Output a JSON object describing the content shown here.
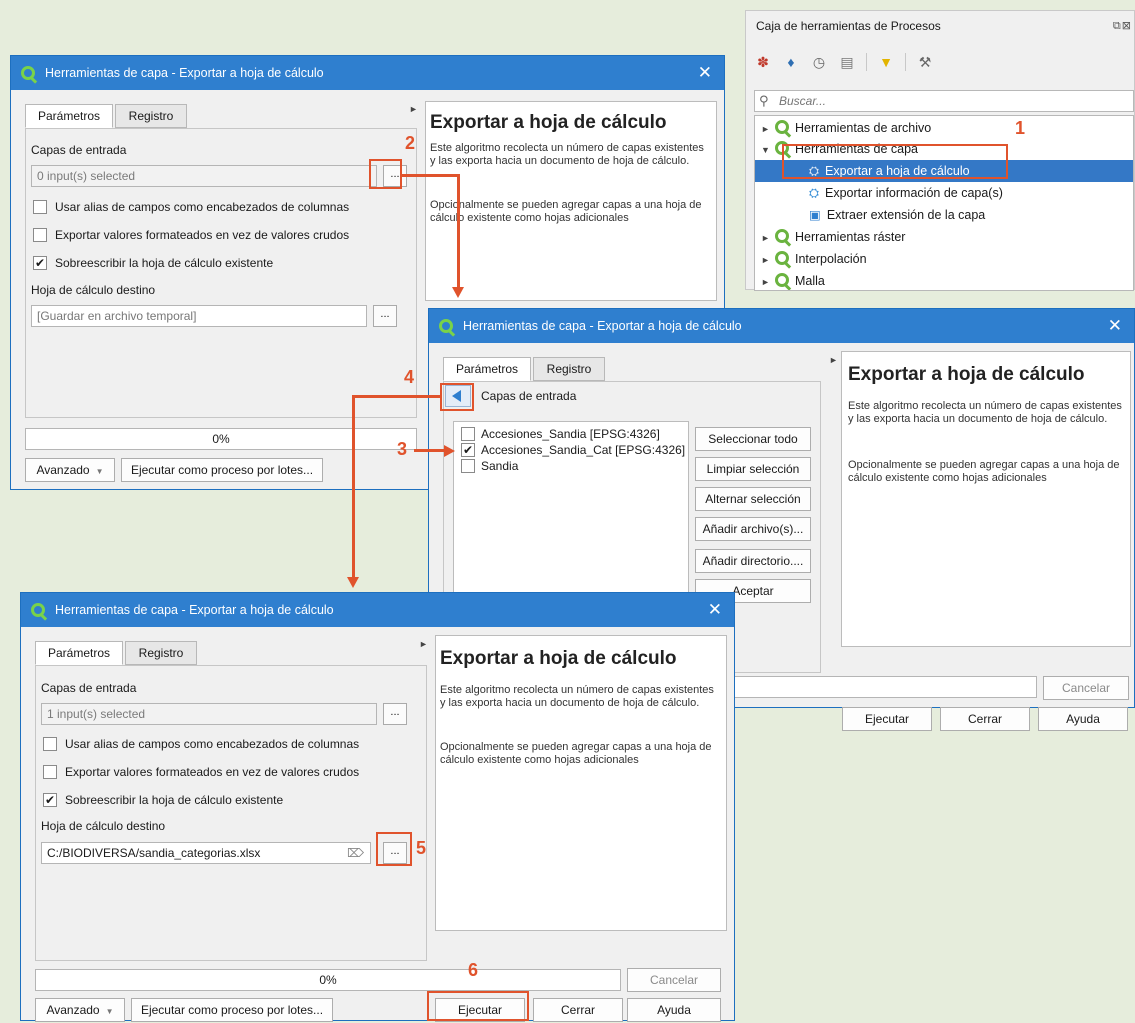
{
  "toolbox": {
    "title": "Caja de herramientas de Procesos",
    "window_buttons": "⧉⊠",
    "search_placeholder": "Buscar...",
    "toolbar_icons": [
      "models-icon",
      "python-script-icon",
      "history-icon",
      "results-viewer-icon",
      "edit-rendering-styles-icon",
      "options-wrench-icon"
    ],
    "tree": [
      {
        "label": "Herramientas de archivo",
        "expanded": false
      },
      {
        "label": "Herramientas de capa",
        "expanded": true
      },
      {
        "label": "Exportar a hoja de cálculo",
        "selected": true
      },
      {
        "label": "Exportar información de capa(s)"
      },
      {
        "label": "Extraer extensión de la capa"
      },
      {
        "label": "Herramientas ráster",
        "expanded": false
      },
      {
        "label": "Interpolación",
        "expanded": false
      },
      {
        "label": "Malla",
        "expanded": false
      }
    ]
  },
  "dialog_title": "Herramientas de capa - Exportar a hoja de cálculo",
  "tabs": {
    "params": "Parámetros",
    "log": "Registro"
  },
  "form": {
    "input_layers_label": "Capas de entrada",
    "input_layers_value_before": "0 input(s) selected",
    "input_layers_value_after": "1 input(s) selected",
    "use_alias": "Usar alias de campos como encabezados de columnas",
    "formatted_values": "Exportar valores formateados en vez de valores crudos",
    "overwrite": "Sobreescribir la hoja de cálculo existente",
    "destination_label": "Hoja de cálculo destino",
    "destination_placeholder": "[Guardar en archivo temporal]",
    "destination_value": "C:/BIODIVERSA/sandia_categorias.xlsx",
    "browse": "..."
  },
  "info": {
    "heading": "Exportar a hoja de cálculo",
    "para1": "Este algoritmo recolecta un número de capas existentes y las exporta hacia un documento de hoja de cálculo.",
    "para2": "Opcionalmente se pueden agregar capas a una hoja de cálculo existente como hojas adicionales"
  },
  "footer": {
    "progress": "0%",
    "progress_fraction": 0,
    "cancel": "Cancelar",
    "advanced": "Avanzado",
    "batch": "Ejecutar como proceso por lotes...",
    "run": "Ejecutar",
    "close": "Cerrar",
    "help": "Ayuda"
  },
  "selector": {
    "title": "Capas de entrada",
    "layers": [
      {
        "name": "Accesiones_Sandia [EPSG:4326]",
        "checked": false
      },
      {
        "name": "Accesiones_Sandia_Cat [EPSG:4326]",
        "checked": true
      },
      {
        "name": "Sandia",
        "checked": false
      }
    ],
    "buttons": [
      "Seleccionar todo",
      "Limpiar selección",
      "Alternar selección",
      "Añadir archivo(s)...",
      "Añadir directorio....",
      "Aceptar"
    ],
    "partial_progress": "%"
  },
  "steps": [
    "1",
    "2",
    "3",
    "4",
    "5",
    "6"
  ],
  "colors": {
    "titlebar": "#2f7fcf",
    "selection": "#3478c6",
    "annotation": "#e0532c",
    "qgis_green": "#6ab33f"
  }
}
